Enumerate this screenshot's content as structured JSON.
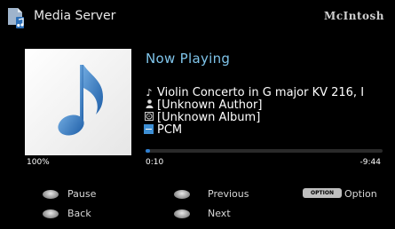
{
  "header": {
    "app_title": "Media Server",
    "brand": "McIntosh",
    "app_icon": "music-file-icon"
  },
  "now_playing": {
    "heading": "Now Playing",
    "track": "Violin Concerto in G major KV 216, I",
    "artist": "[Unknown Author]",
    "album": "[Unknown Album]",
    "format": "PCM",
    "icons": {
      "track": "music-note-icon",
      "artist": "person-icon",
      "album": "disc-icon",
      "format": "waveform-icon"
    }
  },
  "playback": {
    "volume": "100%",
    "elapsed": "0:10",
    "remaining": "-9:44",
    "progress_fraction": 0.017
  },
  "controls": {
    "pause": "Pause",
    "back": "Back",
    "previous": "Previous",
    "next": "Next",
    "option_key": "OPTION",
    "option": "Option"
  },
  "colors": {
    "accent": "#7fc4ea",
    "progress": "#2f7fd0",
    "background": "#000000"
  }
}
